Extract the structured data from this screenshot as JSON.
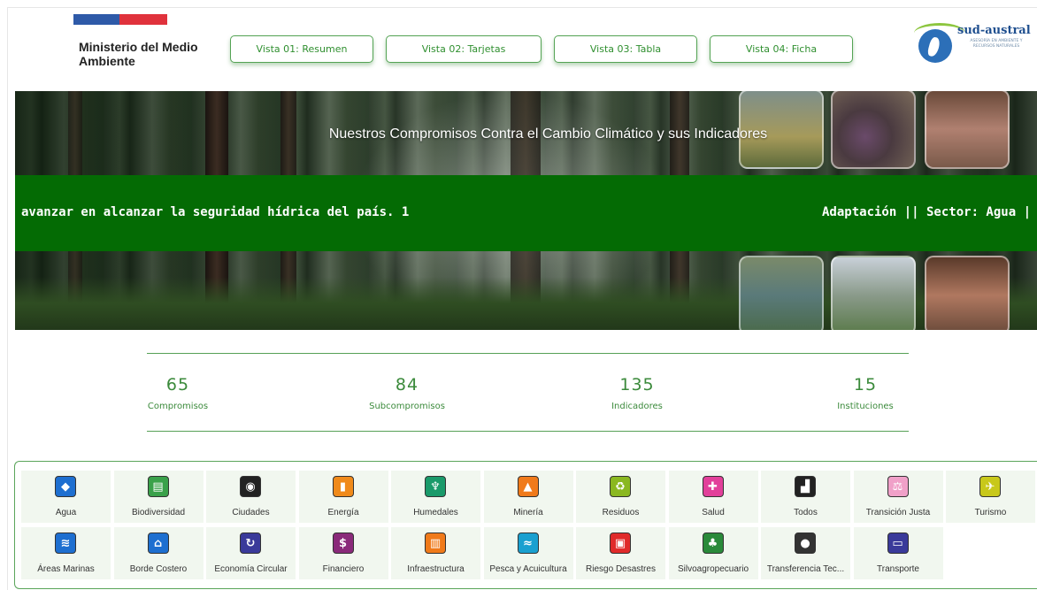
{
  "header": {
    "ministry": "Ministerio del Medio Ambiente",
    "nav": [
      "Vista 01: Resumen",
      "Vista 02: Tarjetas",
      "Vista 03: Tabla",
      "Vista 04: Ficha"
    ],
    "partner_logo": "sud-austral",
    "partner_tagline": "ASESORÍA EN AMBIENTE Y RECURSOS NATURALES"
  },
  "hero": {
    "title": "Nuestros Compromisos Contra el Cambio Climático y sus Indicadores",
    "ticker_left": "avanzar en alcanzar la seguridad hídrica del país. 1",
    "ticker_right": "Adaptación || Sector: Agua |"
  },
  "stats": [
    {
      "value": "65",
      "label": "Compromisos"
    },
    {
      "value": "84",
      "label": "Subcompromisos"
    },
    {
      "value": "135",
      "label": "Indicadores"
    },
    {
      "value": "15",
      "label": "Instituciones"
    }
  ],
  "sectors_row1": [
    {
      "label": "Agua",
      "icon": "water-drop-icon",
      "color": "#1e6fd0",
      "glyph": "◆"
    },
    {
      "label": "Biodiversidad",
      "icon": "biodiversity-icon",
      "color": "#3aa14a",
      "glyph": "▤"
    },
    {
      "label": "Ciudades",
      "icon": "city-pin-icon",
      "color": "#222222",
      "glyph": "◉"
    },
    {
      "label": "Energía",
      "icon": "energy-icon",
      "color": "#f08a1a",
      "glyph": "▮"
    },
    {
      "label": "Humedales",
      "icon": "wetlands-icon",
      "color": "#1a9a6a",
      "glyph": "♆"
    },
    {
      "label": "Minería",
      "icon": "mining-icon",
      "color": "#f07a1a",
      "glyph": "▲"
    },
    {
      "label": "Residuos",
      "icon": "recycle-icon",
      "color": "#8ab820",
      "glyph": "♻"
    },
    {
      "label": "Salud",
      "icon": "health-icon",
      "color": "#e2409a",
      "glyph": "✚"
    },
    {
      "label": "Todos",
      "icon": "factory-icon",
      "color": "#222222",
      "glyph": "▟"
    },
    {
      "label": "Transición Justa",
      "icon": "scales-icon",
      "color": "#f0a0c8",
      "glyph": "⚖"
    },
    {
      "label": "Turismo",
      "icon": "tourism-icon",
      "color": "#c8c81a",
      "glyph": "✈"
    }
  ],
  "sectors_row2": [
    {
      "label": "Áreas Marinas",
      "icon": "waves-icon",
      "color": "#1e6fd0",
      "glyph": "≋"
    },
    {
      "label": "Borde Costero",
      "icon": "coast-icon",
      "color": "#1e6fd0",
      "glyph": "⌂"
    },
    {
      "label": "Economía Circular",
      "icon": "circular-economy-icon",
      "color": "#3a3a9a",
      "glyph": "↻"
    },
    {
      "label": "Financiero",
      "icon": "finance-icon",
      "color": "#8a2a7a",
      "glyph": "$"
    },
    {
      "label": "Infraestructura",
      "icon": "building-icon",
      "color": "#f07a1a",
      "glyph": "▥"
    },
    {
      "label": "Pesca y Acuicultura",
      "icon": "fishing-icon",
      "color": "#1aa0d0",
      "glyph": "≈"
    },
    {
      "label": "Riesgo Desastres",
      "icon": "fire-truck-icon",
      "color": "#e02a2a",
      "glyph": "▣"
    },
    {
      "label": "Silvoagropecuario",
      "icon": "tree-icon",
      "color": "#2a8a3a",
      "glyph": "♣"
    },
    {
      "label": "Transferencia Tec...",
      "icon": "tech-transfer-icon",
      "color": "#333333",
      "glyph": "●"
    },
    {
      "label": "Transporte",
      "icon": "bus-icon",
      "color": "#3a3a9a",
      "glyph": "▭"
    }
  ]
}
